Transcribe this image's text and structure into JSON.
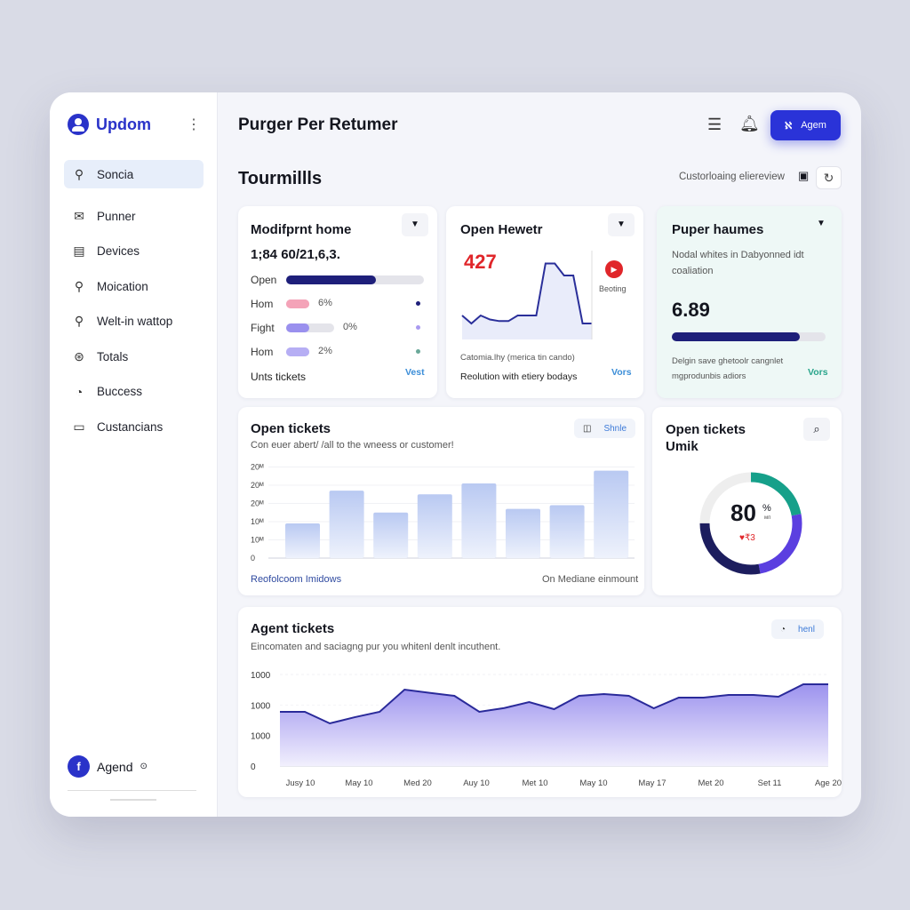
{
  "sidebar": {
    "brand": "Updom",
    "menu_icon": "more-vertical-icon",
    "items": [
      {
        "label": "Soncia",
        "icon": "search-icon",
        "active": true
      },
      {
        "label": "Punner",
        "icon": "mail-icon"
      },
      {
        "label": "Devices",
        "icon": "devices-icon"
      },
      {
        "label": "Moication",
        "icon": "search-icon"
      },
      {
        "label": "Welt-in wattop",
        "icon": "magnifier-icon"
      },
      {
        "label": "Totals",
        "icon": "totals-icon"
      },
      {
        "label": "Buccess",
        "icon": "success-icon"
      },
      {
        "label": "Custancians",
        "icon": "monitor-icon"
      }
    ],
    "user": {
      "name": "Agend",
      "avatar_letter": "f"
    }
  },
  "header": {
    "title": "Purger Per Retumer",
    "agent_button": "Agem",
    "accent": "#2a33d8"
  },
  "section": {
    "title": "Tourmillls",
    "customize": "Custorloaing eliereview"
  },
  "card1": {
    "title": "Modifprnt home",
    "value": "1;84 60/21,6,3.",
    "rows": [
      {
        "label": "Open",
        "pct": null,
        "fill": 0.65,
        "color": "#1e1f7a"
      },
      {
        "label": "Hom",
        "pct": "6%",
        "color": "#f4a3b8",
        "dot": "#1e1f7a"
      },
      {
        "label": "Fight",
        "pct": "0%",
        "color": "#9a90ee",
        "dot": "#a99af0"
      },
      {
        "label": "Hom",
        "pct": "2%",
        "color": "#b6aef4",
        "dot": "#6aa899"
      }
    ],
    "footer": "Unts tickets",
    "link": "Vest"
  },
  "card2": {
    "title": "Open Hewetr",
    "value": "427",
    "value_color": "#e0262a",
    "side_label": "Beoting",
    "caption": "Catomia.lhy (merica tin cando)",
    "footer": "Reolution with etiery bodays",
    "link": "Vors",
    "spark": [
      3,
      2,
      3,
      2.5,
      2.3,
      2.3,
      3,
      3,
      3,
      9.5,
      9.5,
      8,
      8,
      2,
      2
    ]
  },
  "card3": {
    "title": "Puper haumes",
    "desc": "Nodal whites in Dabyonned idt coaliation",
    "value": "6.89",
    "progress": 0.83,
    "footer": "Delgin save ghetoolr cangnlet mgprodunbis adiors",
    "link": "Vors",
    "bg": "#eef8f6"
  },
  "bars_card": {
    "title": "Open tickets",
    "subtitle": "Con euer abert/ /all to the wneess or customer!",
    "chip": "Shnle",
    "footer_left": "Reofolcoom Imidows",
    "footer_right": "On Mediane einmount"
  },
  "donut_card": {
    "title": "Open tickets Umik",
    "value": "80",
    "unit": "%",
    "unit_sub": "мп",
    "sub": "♥₹3",
    "segments": [
      {
        "color": "#16a08a",
        "share": 0.22
      },
      {
        "color": "#5b3fe0",
        "share": 0.25
      },
      {
        "color": "#1c1d5e",
        "share": 0.28
      },
      {
        "color": "#eeeeee",
        "share": 0.25
      }
    ]
  },
  "area_card": {
    "title": "Agent tickets",
    "subtitle": "Eincomaten and saciagng pur you whitenl denlt incuthent.",
    "chip": "henl"
  },
  "chart_data": [
    {
      "type": "bar",
      "yticks": [
        "0",
        "10ᴹ",
        "10ᴹ",
        "20ᴹ",
        "20ᴹ",
        "20ᴹ"
      ],
      "ylim": [
        0,
        5
      ],
      "values": [
        1.9,
        3.7,
        2.5,
        3.5,
        4.1,
        2.7,
        2.9,
        4.8
      ],
      "grid": true
    },
    {
      "type": "area",
      "yticks": [
        "0",
        "1000",
        "1000",
        "1000"
      ],
      "ylim": [
        0,
        3000
      ],
      "xticks": [
        "Jusy 10",
        "May 10",
        "Med 20",
        "Auy 10",
        "Met 10",
        "May 10",
        "May 17",
        "Met 20",
        "Set 11",
        "Age 20"
      ],
      "values": [
        1777,
        1777,
        1398,
        1600,
        1777,
        2505,
        2400,
        2301,
        1777,
        1900,
        2097,
        1864,
        2301,
        2359,
        2301,
        1893,
        2243,
        2243,
        2330,
        2330,
        2272,
        2680,
        2680
      ],
      "grid": true
    }
  ]
}
